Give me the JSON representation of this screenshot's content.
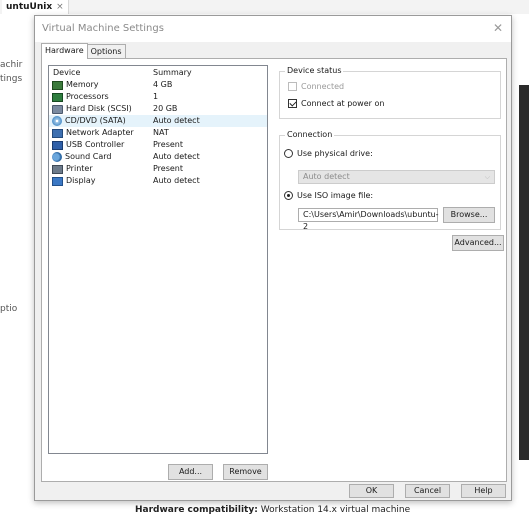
{
  "host": {
    "tab_label": "untuUnix",
    "tab_close_glyph": "×",
    "side_text_1": "achir",
    "side_text_2": "tings",
    "side_text_3": "ptio",
    "footer_label": "Hardware compatibility:",
    "footer_value": "Workstation 14.x virtual machine"
  },
  "dialog": {
    "title": "Virtual Machine Settings",
    "close_glyph": "✕",
    "tabs": [
      "Hardware",
      "Options"
    ],
    "active_tab": "Hardware",
    "list": {
      "headers": {
        "device": "Device",
        "summary": "Summary"
      },
      "rows": [
        {
          "device": "Memory",
          "summary": "4 GB",
          "icon": "memory-icon"
        },
        {
          "device": "Processors",
          "summary": "1",
          "icon": "processor-icon"
        },
        {
          "device": "Hard Disk (SCSI)",
          "summary": "20 GB",
          "icon": "hard-disk-icon"
        },
        {
          "device": "CD/DVD (SATA)",
          "summary": "Auto detect",
          "icon": "cd-dvd-icon",
          "selected": true
        },
        {
          "device": "Network Adapter",
          "summary": "NAT",
          "icon": "network-adapter-icon"
        },
        {
          "device": "USB Controller",
          "summary": "Present",
          "icon": "usb-controller-icon"
        },
        {
          "device": "Sound Card",
          "summary": "Auto detect",
          "icon": "sound-card-icon"
        },
        {
          "device": "Printer",
          "summary": "Present",
          "icon": "printer-icon"
        },
        {
          "device": "Display",
          "summary": "Auto detect",
          "icon": "display-icon"
        }
      ]
    },
    "buttons": {
      "add": "Add...",
      "remove": "Remove"
    },
    "device_status": {
      "label": "Device status",
      "connected": "Connected",
      "connect_at_power_on": "Connect at power on"
    },
    "connection": {
      "label": "Connection",
      "use_physical": "Use physical drive:",
      "physical_value": "Auto detect",
      "use_iso": "Use ISO image file:",
      "iso_path": "C:\\Users\\Amir\\Downloads\\ubuntu-2",
      "browse": "Browse...",
      "chevron_glyph": "⌵"
    },
    "advanced": "Advanced...",
    "footer": {
      "ok": "OK",
      "cancel": "Cancel",
      "help": "Help"
    }
  },
  "colors": {
    "selection": "#e5f3fb",
    "dialog_bg": "#f0f0f0",
    "button_bg": "#e1e1e1"
  }
}
